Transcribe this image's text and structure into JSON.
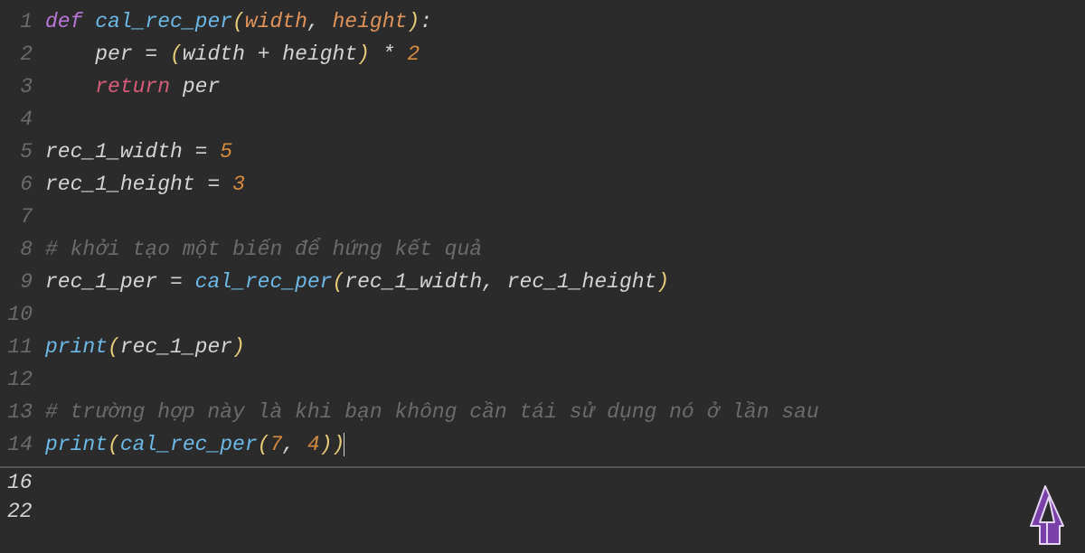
{
  "lines": [
    {
      "n": "1",
      "tokens": [
        {
          "t": "def ",
          "c": "kw-def"
        },
        {
          "t": "cal_rec_per",
          "c": "fn"
        },
        {
          "t": "(",
          "c": "punct"
        },
        {
          "t": "width",
          "c": "param"
        },
        {
          "t": ", ",
          "c": "op"
        },
        {
          "t": "height",
          "c": "param"
        },
        {
          "t": ")",
          "c": "punct"
        },
        {
          "t": ":",
          "c": "op"
        }
      ]
    },
    {
      "n": "2",
      "tokens": [
        {
          "t": "    per ",
          "c": "id"
        },
        {
          "t": "=",
          "c": "op"
        },
        {
          "t": " ",
          "c": "id"
        },
        {
          "t": "(",
          "c": "punct"
        },
        {
          "t": "width ",
          "c": "id"
        },
        {
          "t": "+",
          "c": "op"
        },
        {
          "t": " height",
          "c": "id"
        },
        {
          "t": ")",
          "c": "punct"
        },
        {
          "t": " ",
          "c": "id"
        },
        {
          "t": "*",
          "c": "op"
        },
        {
          "t": " ",
          "c": "id"
        },
        {
          "t": "2",
          "c": "num"
        }
      ]
    },
    {
      "n": "3",
      "tokens": [
        {
          "t": "    ",
          "c": "id"
        },
        {
          "t": "return",
          "c": "kw-ret"
        },
        {
          "t": " per",
          "c": "id"
        }
      ]
    },
    {
      "n": "4",
      "tokens": []
    },
    {
      "n": "5",
      "tokens": [
        {
          "t": "rec_1_width ",
          "c": "id"
        },
        {
          "t": "=",
          "c": "op"
        },
        {
          "t": " ",
          "c": "id"
        },
        {
          "t": "5",
          "c": "num"
        }
      ]
    },
    {
      "n": "6",
      "tokens": [
        {
          "t": "rec_1_height ",
          "c": "id"
        },
        {
          "t": "=",
          "c": "op"
        },
        {
          "t": " ",
          "c": "id"
        },
        {
          "t": "3",
          "c": "num"
        }
      ]
    },
    {
      "n": "7",
      "tokens": []
    },
    {
      "n": "8",
      "tokens": [
        {
          "t": "# khởi tạo một biến để hứng kết quả",
          "c": "comment"
        }
      ]
    },
    {
      "n": "9",
      "tokens": [
        {
          "t": "rec_1_per ",
          "c": "id"
        },
        {
          "t": "=",
          "c": "op"
        },
        {
          "t": " ",
          "c": "id"
        },
        {
          "t": "cal_rec_per",
          "c": "fn"
        },
        {
          "t": "(",
          "c": "punct"
        },
        {
          "t": "rec_1_width",
          "c": "id"
        },
        {
          "t": ", ",
          "c": "op"
        },
        {
          "t": "rec_1_height",
          "c": "id"
        },
        {
          "t": ")",
          "c": "punct"
        }
      ]
    },
    {
      "n": "10",
      "tokens": []
    },
    {
      "n": "11",
      "tokens": [
        {
          "t": "print",
          "c": "fn"
        },
        {
          "t": "(",
          "c": "punct"
        },
        {
          "t": "rec_1_per",
          "c": "id"
        },
        {
          "t": ")",
          "c": "punct"
        }
      ]
    },
    {
      "n": "12",
      "tokens": []
    },
    {
      "n": "13",
      "tokens": [
        {
          "t": "# trường hợp này là khi bạn không cần tái sử dụng nó ở lần sau",
          "c": "comment"
        }
      ]
    },
    {
      "n": "14",
      "tokens": [
        {
          "t": "print",
          "c": "fn"
        },
        {
          "t": "(",
          "c": "punct"
        },
        {
          "t": "cal_rec_per",
          "c": "fn"
        },
        {
          "t": "(",
          "c": "punct"
        },
        {
          "t": "7",
          "c": "num"
        },
        {
          "t": ", ",
          "c": "op"
        },
        {
          "t": "4",
          "c": "num"
        },
        {
          "t": ")",
          "c": "punct"
        },
        {
          "t": ")",
          "c": "punct"
        }
      ],
      "cursor": true
    }
  ],
  "output": [
    "16",
    "22"
  ]
}
